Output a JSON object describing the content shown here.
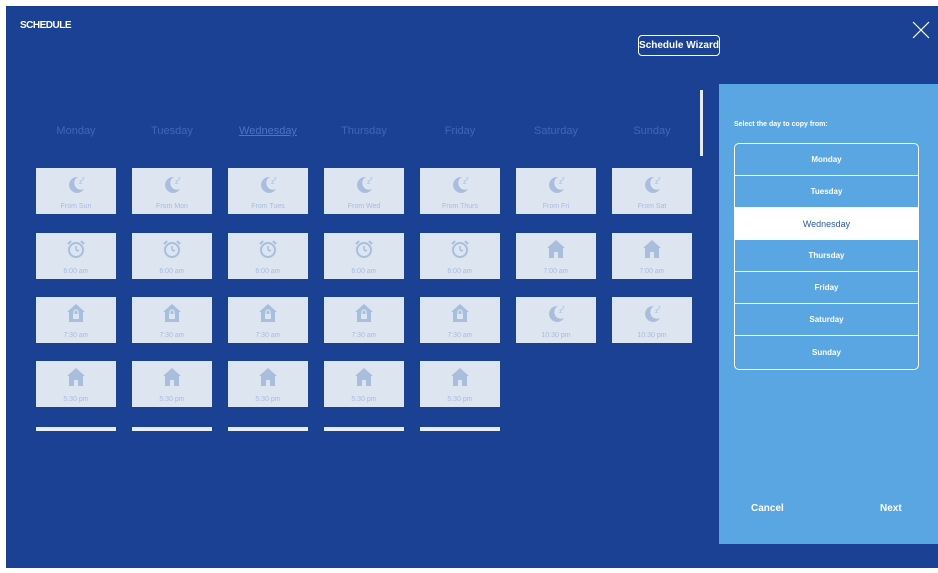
{
  "header": {
    "title": "SCHEDULE",
    "wizard_label": "Schedule Wizard"
  },
  "days": [
    {
      "label": "Monday",
      "selected": false
    },
    {
      "label": "Tuesday",
      "selected": false
    },
    {
      "label": "Wednesday",
      "selected": true
    },
    {
      "label": "Thursday",
      "selected": false
    },
    {
      "label": "Friday",
      "selected": false
    },
    {
      "label": "Saturday",
      "selected": false
    },
    {
      "label": "Sunday",
      "selected": false
    }
  ],
  "grid": [
    [
      {
        "icon": "moon-icon",
        "label": "From Sun"
      },
      {
        "icon": "alarm-clock-icon",
        "label": "6:00 am"
      },
      {
        "icon": "lock-house-icon",
        "label": "7:30 am"
      },
      {
        "icon": "house-icon",
        "label": "5:30 pm"
      }
    ],
    [
      {
        "icon": "moon-icon",
        "label": "From Mon"
      },
      {
        "icon": "alarm-clock-icon",
        "label": "6:00 am"
      },
      {
        "icon": "lock-house-icon",
        "label": "7:30 am"
      },
      {
        "icon": "house-icon",
        "label": "5:30 pm"
      }
    ],
    [
      {
        "icon": "moon-icon",
        "label": "From Tues"
      },
      {
        "icon": "alarm-clock-icon",
        "label": "6:00 am"
      },
      {
        "icon": "lock-house-icon",
        "label": "7:30 am"
      },
      {
        "icon": "house-icon",
        "label": "5:30 pm"
      }
    ],
    [
      {
        "icon": "moon-icon",
        "label": "From Wed"
      },
      {
        "icon": "alarm-clock-icon",
        "label": "6:00 am"
      },
      {
        "icon": "lock-house-icon",
        "label": "7:30 am"
      },
      {
        "icon": "house-icon",
        "label": "5:30 pm"
      }
    ],
    [
      {
        "icon": "moon-icon",
        "label": "From Thurs"
      },
      {
        "icon": "alarm-clock-icon",
        "label": "6:00 am"
      },
      {
        "icon": "lock-house-icon",
        "label": "7:30 am"
      },
      {
        "icon": "house-icon",
        "label": "5:30 pm"
      }
    ],
    [
      {
        "icon": "moon-icon",
        "label": "From Fri"
      },
      {
        "icon": "house-icon",
        "label": "7:00 am"
      },
      {
        "icon": "moon-icon",
        "label": "10:30 pm"
      }
    ],
    [
      {
        "icon": "moon-icon",
        "label": "From Sat"
      },
      {
        "icon": "house-icon",
        "label": "7:00 am"
      },
      {
        "icon": "moon-icon",
        "label": "10:30 pm"
      }
    ]
  ],
  "copy_panel": {
    "prompt": "Select the day to copy from:",
    "options": [
      "Monday",
      "Tuesday",
      "Wednesday",
      "Thursday",
      "Friday",
      "Saturday",
      "Sunday"
    ],
    "selected": "Wednesday",
    "cancel_label": "Cancel",
    "next_label": "Next"
  },
  "colors": {
    "background": "#1b4195",
    "panel": "#5aa6e2",
    "tile": "#dde5f1",
    "text": "#ffffff"
  }
}
